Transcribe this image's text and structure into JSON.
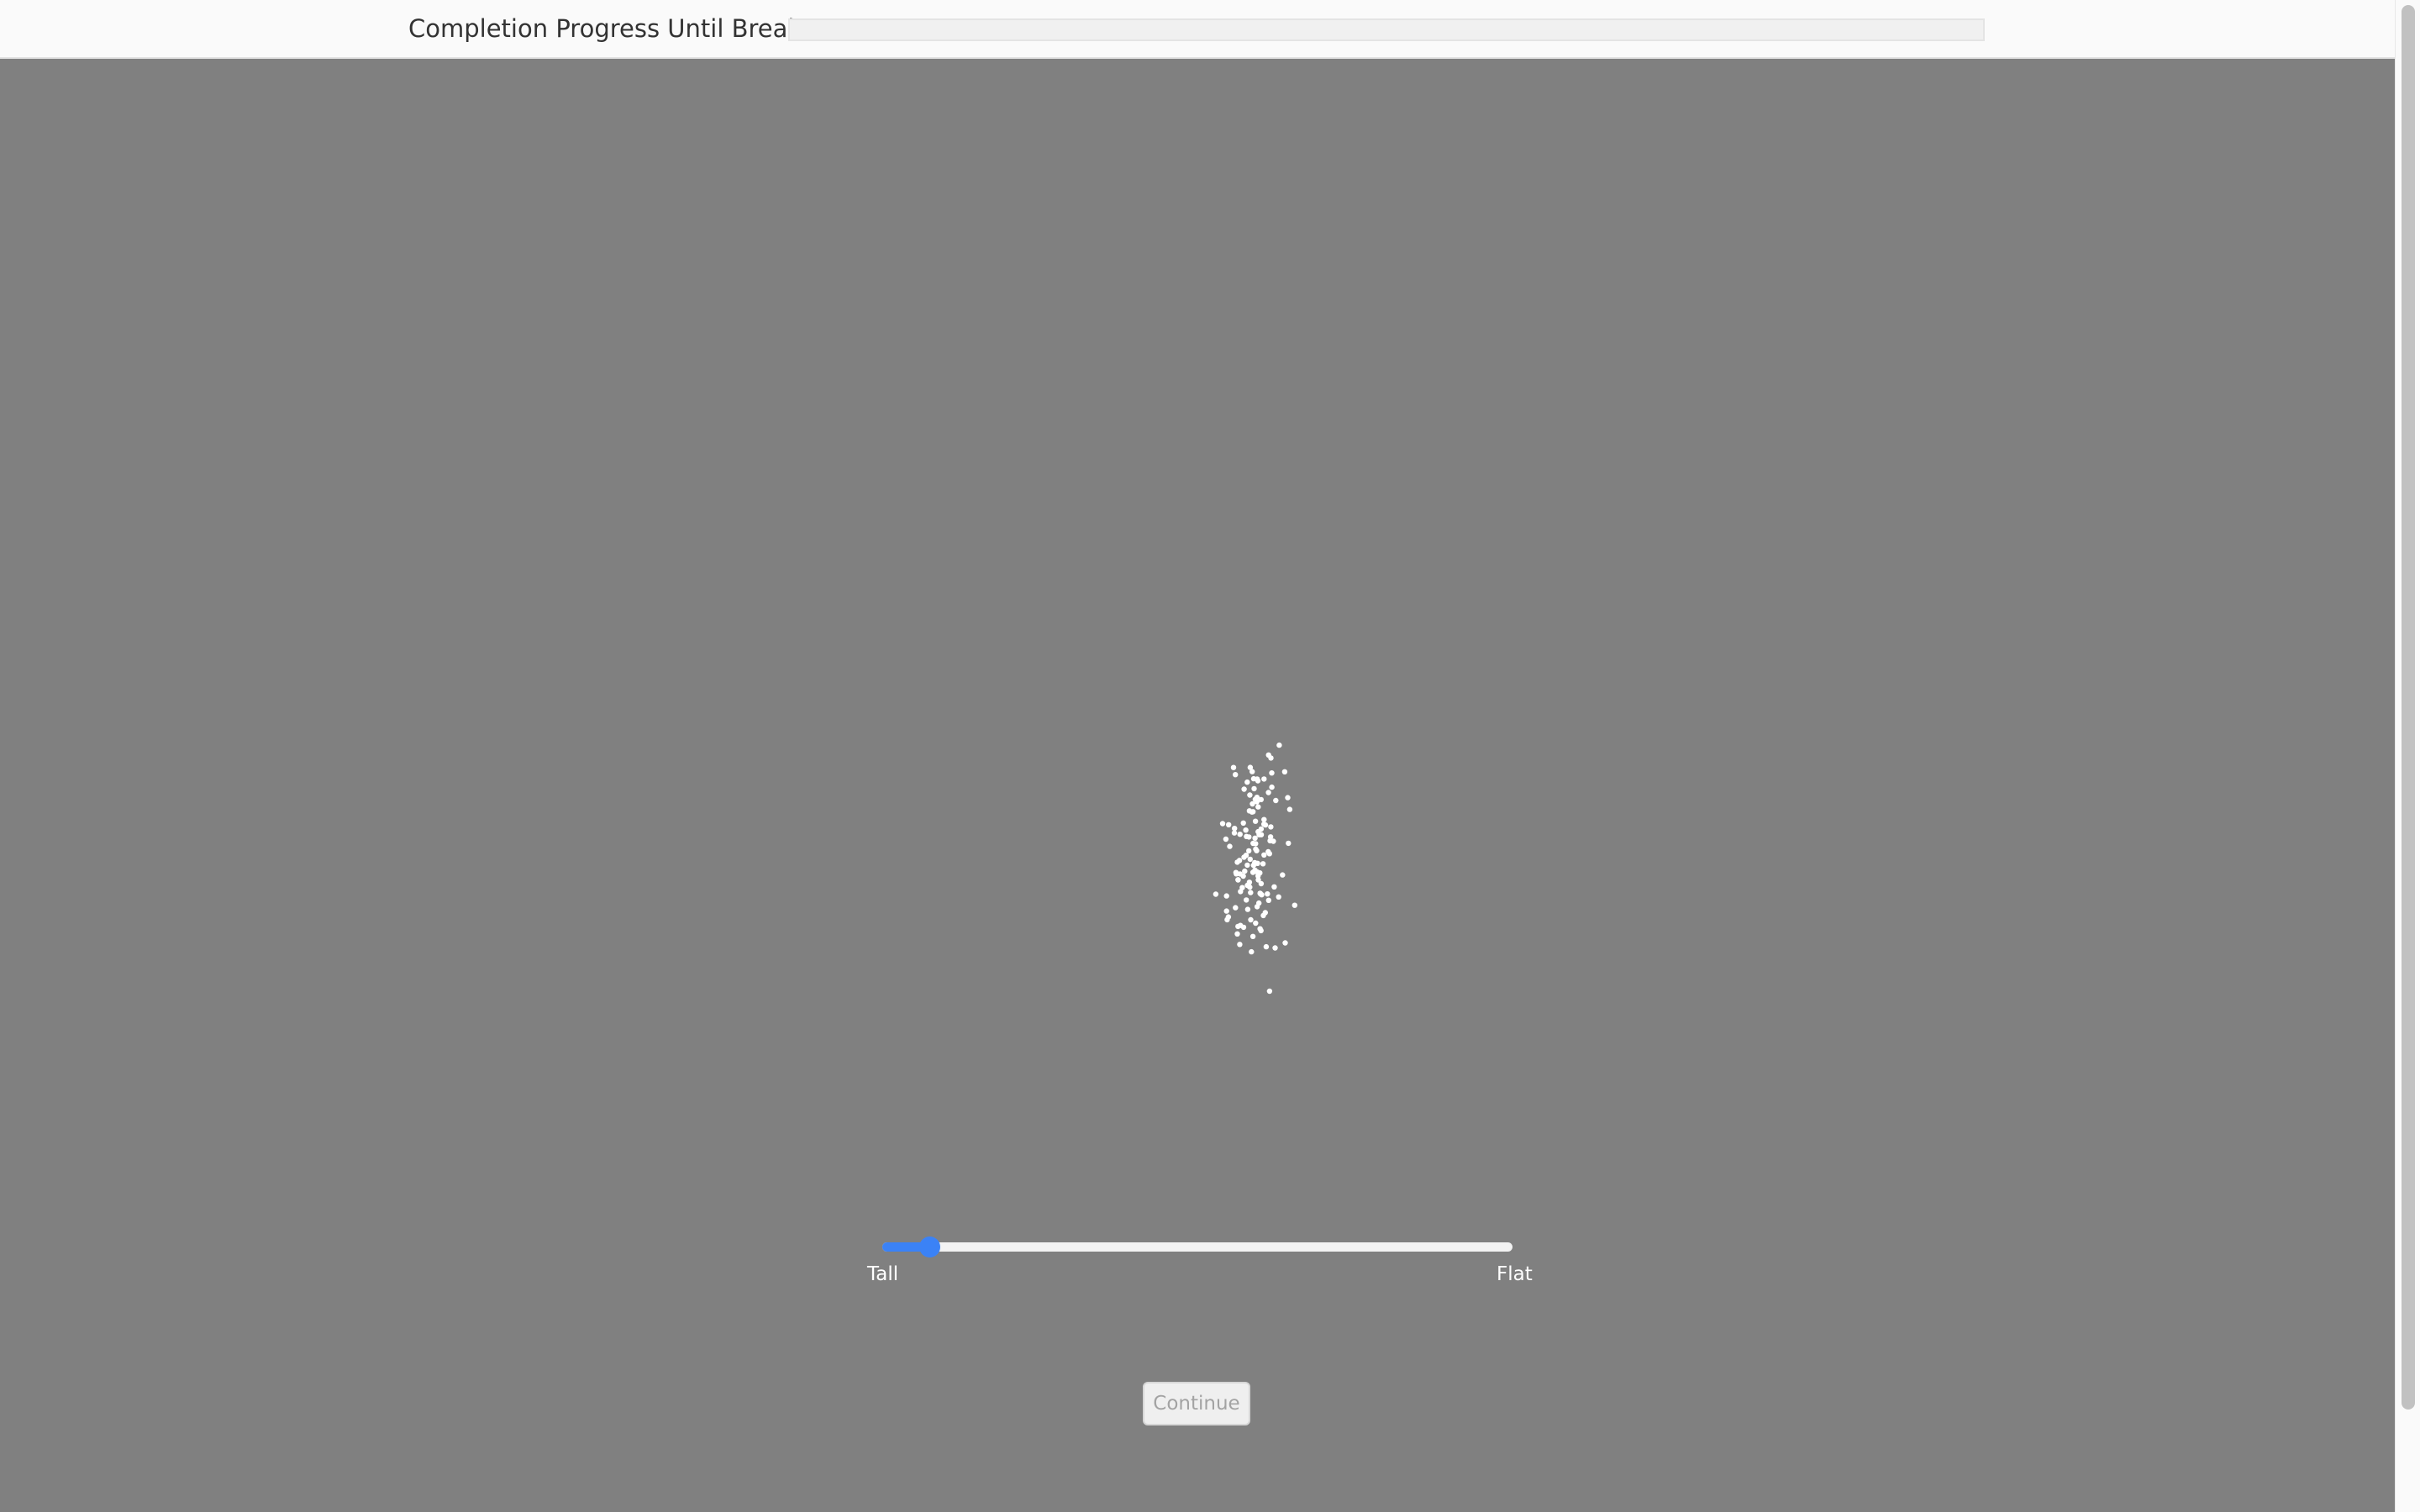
{
  "header": {
    "progress_label": "Completion Progress Until Break",
    "progress_fraction": 0.0
  },
  "stimulus": {
    "dot_color": "#ffffff",
    "background_color": "#808080"
  },
  "slider": {
    "min_label": "Tall",
    "max_label": "Flat",
    "value_fraction": 0.05,
    "accent_color": "#3b82f6"
  },
  "actions": {
    "continue_label": "Continue"
  }
}
